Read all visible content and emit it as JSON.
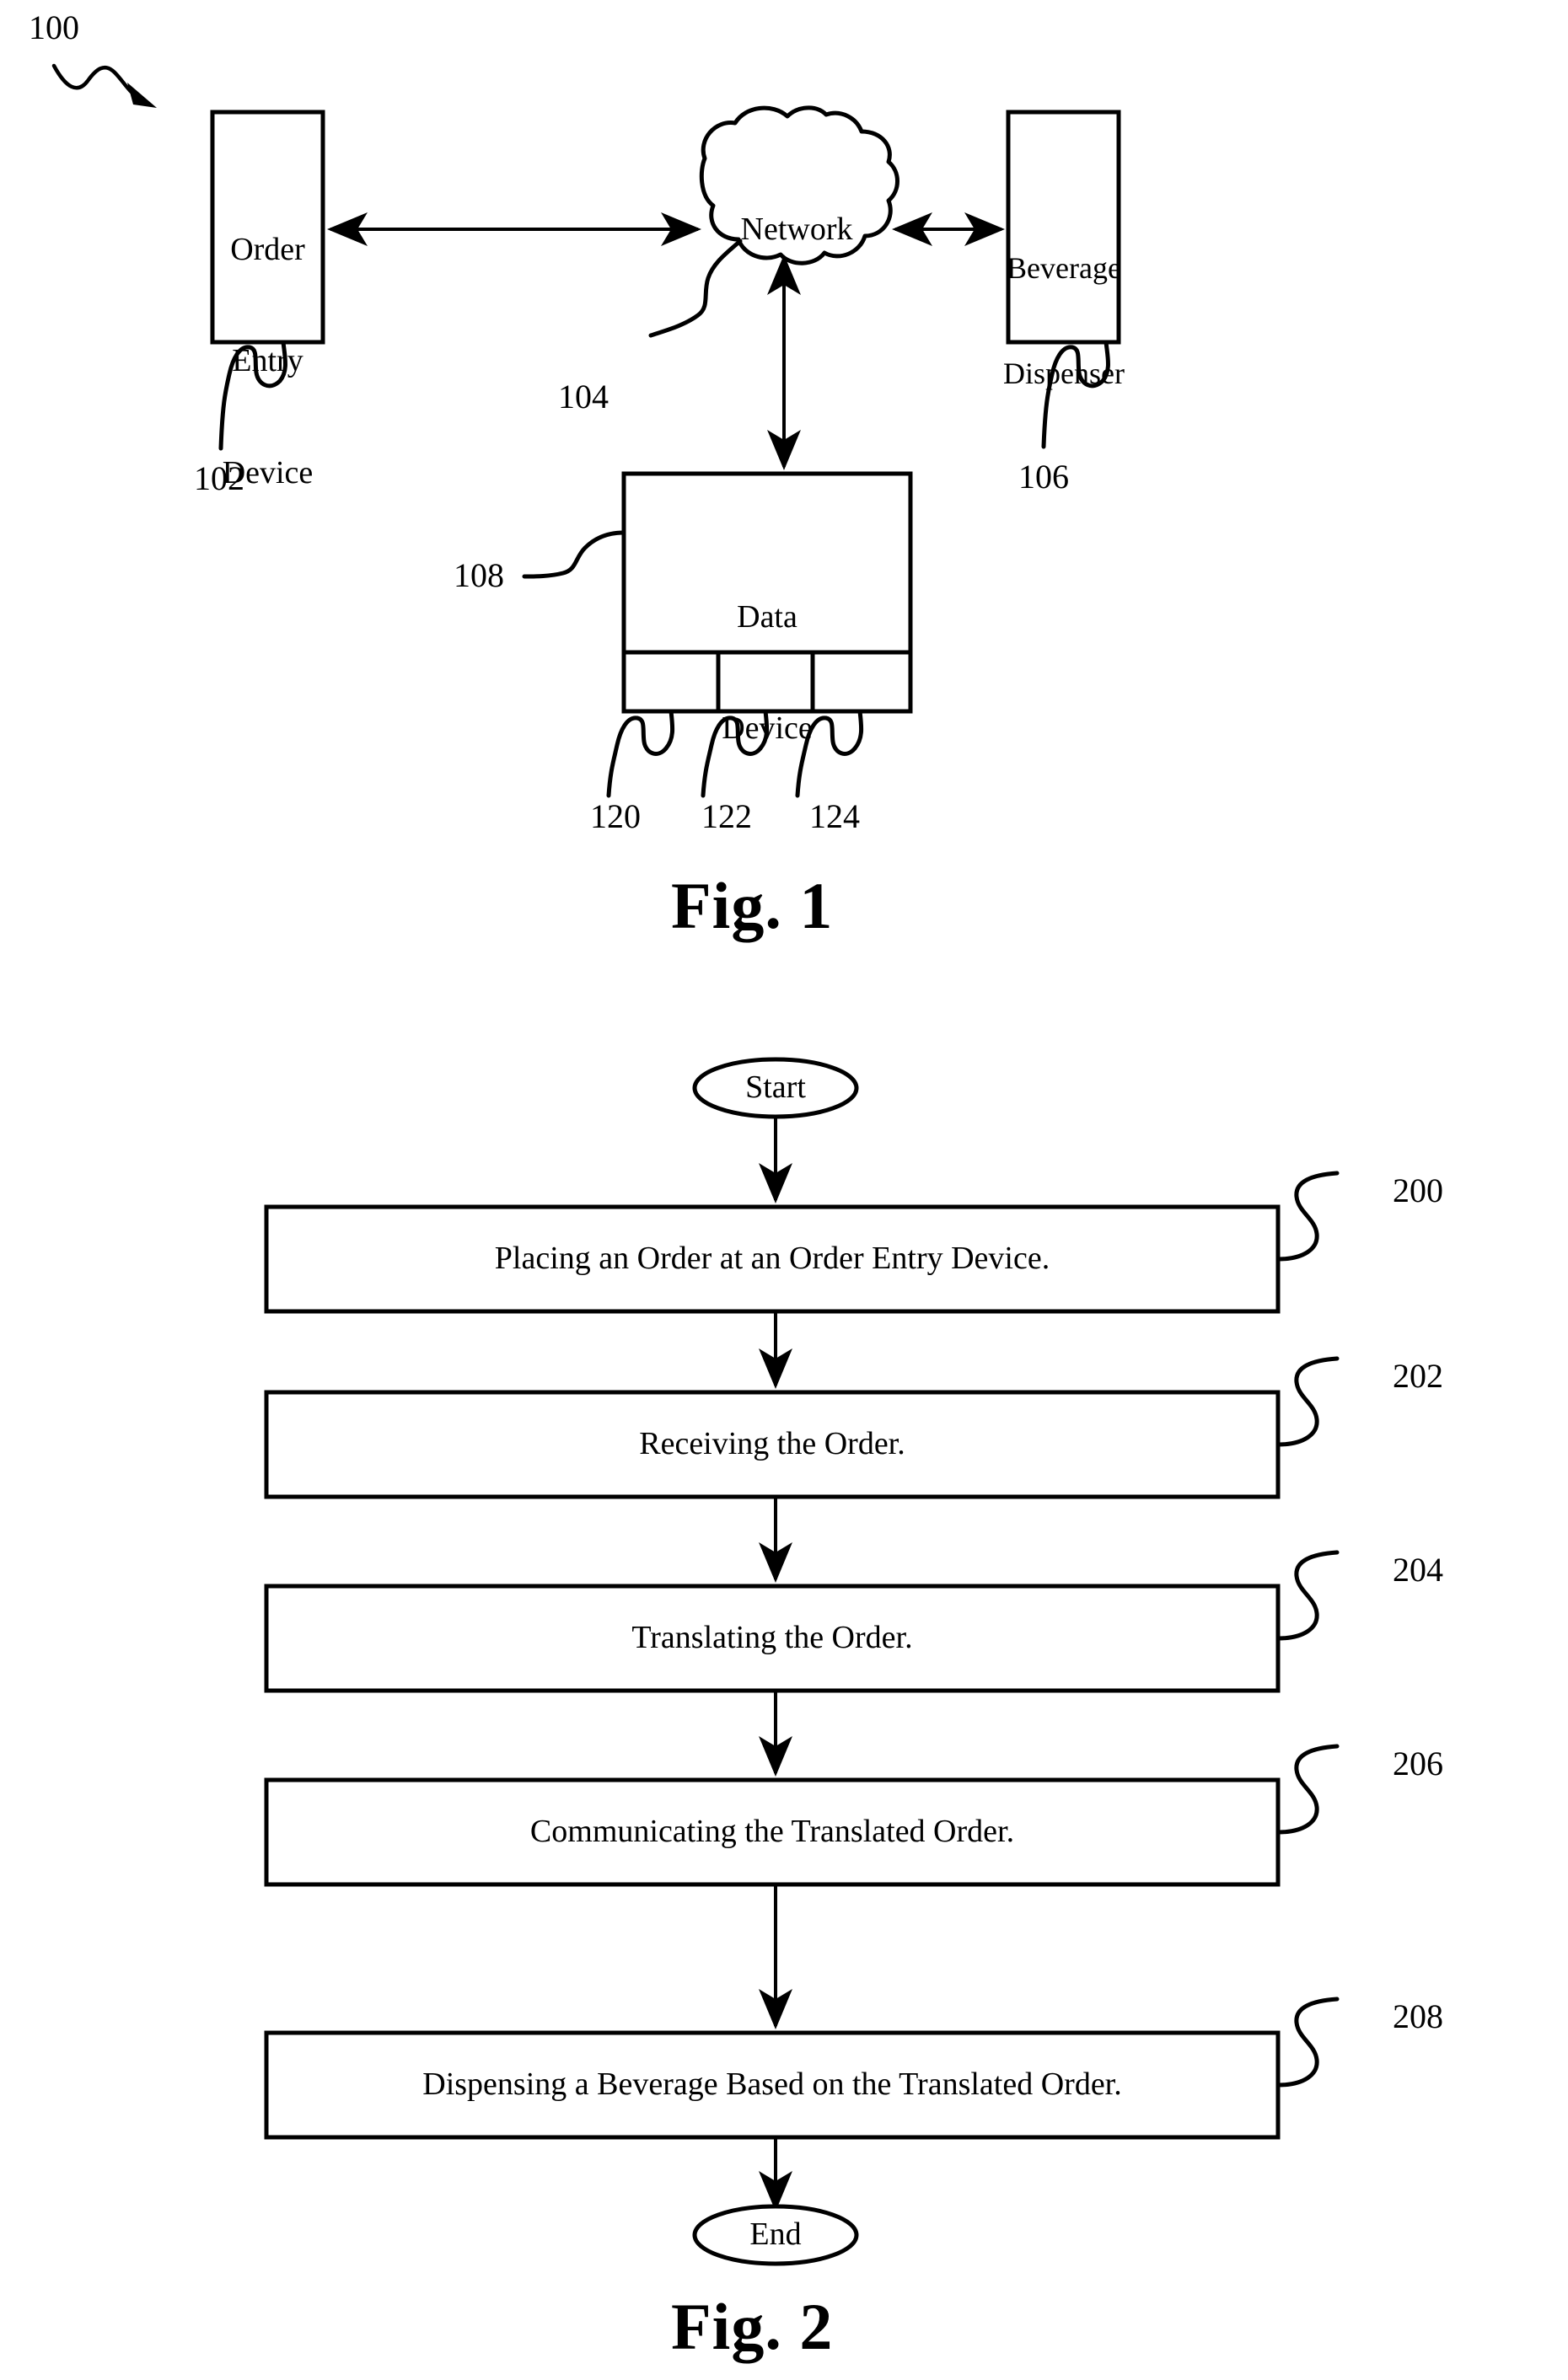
{
  "document": {
    "kind": "patent-drawing-sheet",
    "background_color": "#ffffff",
    "ink_color": "#000000"
  },
  "figure1": {
    "caption": "Fig. 1",
    "system_ref": "100",
    "nodes": [
      {
        "id": "order-entry-device",
        "lines": [
          "Order",
          "Entry",
          "Device"
        ],
        "ref": "102"
      },
      {
        "id": "network",
        "lines": [
          "Network"
        ],
        "ref": "104"
      },
      {
        "id": "beverage-dispenser",
        "lines": [
          "Beverage",
          "Dispenser"
        ],
        "ref": "106"
      },
      {
        "id": "data-device",
        "lines": [
          "Data",
          "Device"
        ],
        "ref": "108"
      }
    ],
    "data_device_compartments": [
      {
        "ref": "120"
      },
      {
        "ref": "122"
      },
      {
        "ref": "124"
      }
    ],
    "connections": [
      {
        "from": "order-entry-device",
        "to": "network",
        "style": "double-arrow"
      },
      {
        "from": "network",
        "to": "beverage-dispenser",
        "style": "double-arrow"
      },
      {
        "from": "network",
        "to": "data-device",
        "style": "double-arrow"
      }
    ]
  },
  "figure2": {
    "caption": "Fig. 2",
    "terminals": {
      "start": "Start",
      "end": "End"
    },
    "steps": [
      {
        "ref": "200",
        "label": "Placing an Order at an Order Entry Device."
      },
      {
        "ref": "202",
        "label": "Receiving the Order."
      },
      {
        "ref": "204",
        "label": "Translating the Order."
      },
      {
        "ref": "206",
        "label": "Communicating the Translated Order."
      },
      {
        "ref": "208",
        "label": "Dispensing a Beverage Based on the Translated Order."
      }
    ]
  }
}
